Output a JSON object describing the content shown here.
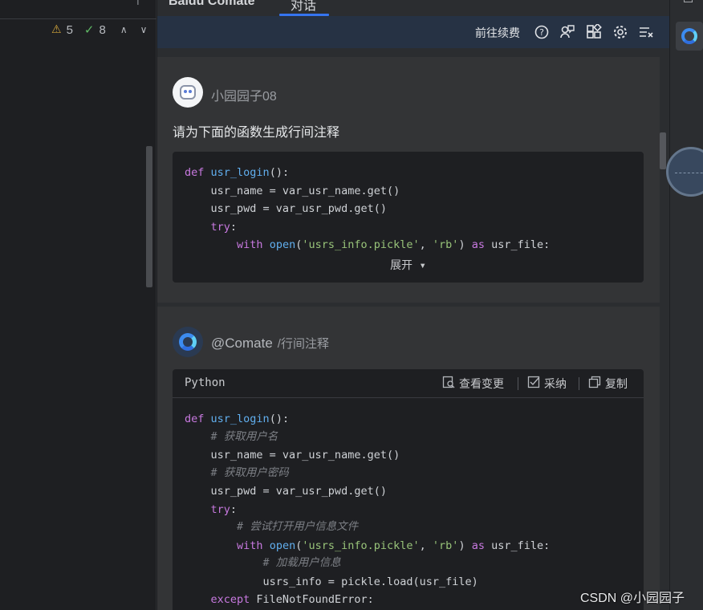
{
  "editor": {
    "top_glyph": "↑",
    "warnings_count": "5",
    "weak_warnings_count": "8",
    "warn_icon": "⚠",
    "check_icon": "✓",
    "nav_up": "∧",
    "nav_down": "∨"
  },
  "panel": {
    "tabs": [
      {
        "label": "Baidu Comate"
      },
      {
        "label": "对话"
      }
    ],
    "toolbar": {
      "renew_label": "前往续费",
      "icons": [
        "help-icon",
        "feedback-icon",
        "plugins-icon",
        "settings-icon",
        "clear-list-icon"
      ]
    }
  },
  "user_message": {
    "username": "小园园子08",
    "question": "请为下面的函数生成行间注释",
    "expand_label": "展开 ▾",
    "code_lines": [
      {
        "k": "def",
        "f": "usr_login",
        "rest": "():"
      },
      {
        "text": "    usr_name = var_usr_name.get()"
      },
      {
        "text": "    usr_pwd = var_usr_pwd.get()"
      },
      {
        "k": "    try",
        "rest": ":"
      },
      {
        "with": true,
        "text": "usrs_info.pickle",
        "text2": "rb"
      }
    ]
  },
  "bot_message": {
    "handle": "@Comate",
    "command": "/行间注释",
    "code_lang": "Python",
    "actions": {
      "view_changes": "查看变更",
      "accept": "采纳",
      "copy": "复制"
    },
    "comments": {
      "c1": "# 获取用户名",
      "c2": "# 获取用户密码",
      "c3": "# 尝试打开用户信息文件",
      "c4": "# 加载用户信息"
    },
    "lines": {
      "l_user": "    usr_name = var_usr_name.get()",
      "l_pwd": "    usr_pwd = var_usr_pwd.get()",
      "l_load": "            usrs_info = pickle.load(usr_file)",
      "l_except": "    except FileNotFoundError:"
    }
  },
  "watermark": "CSDN @小园园子"
}
